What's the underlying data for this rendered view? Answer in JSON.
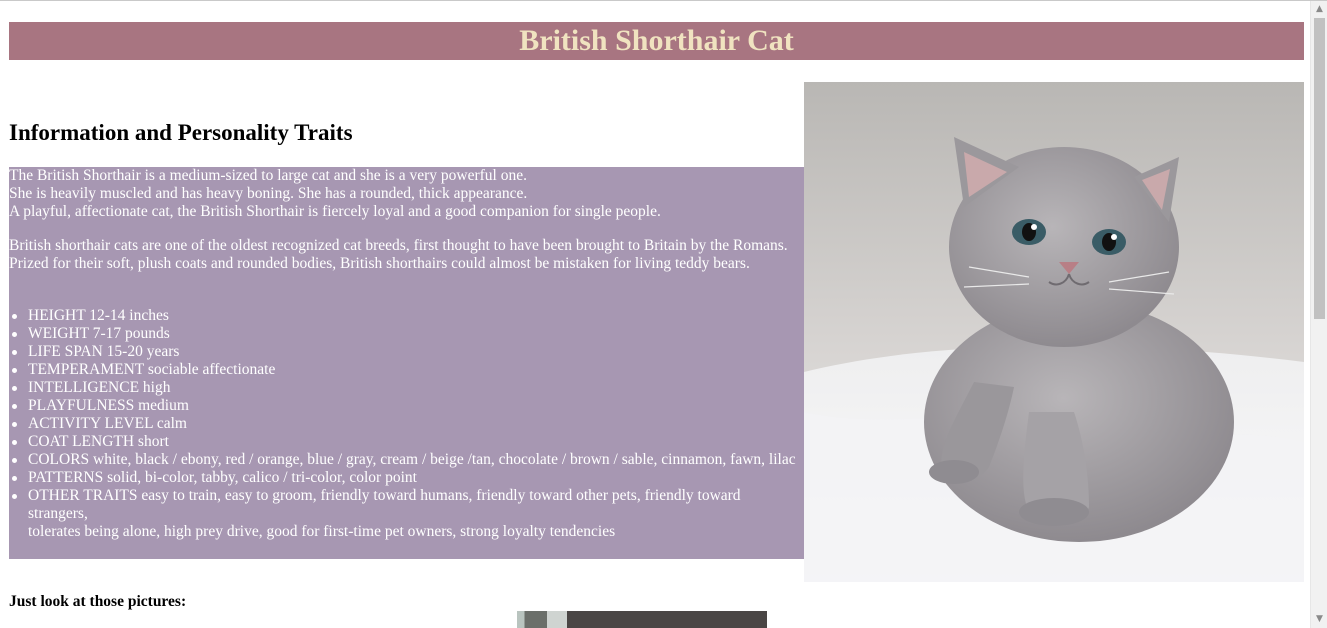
{
  "banner": {
    "title": "British Shorthair Cat"
  },
  "section": {
    "heading": "Information and Personality Traits"
  },
  "info": {
    "p1_lines": [
      "The British Shorthair is a medium-sized to large cat and she is a very powerful one.",
      "She is heavily muscled and has heavy boning. She has a rounded, thick appearance.",
      "A playful, affectionate cat, the British Shorthair is fiercely loyal and a good companion for single people."
    ],
    "p2_lines": [
      "British shorthair cats are one of the oldest recognized cat breeds, first thought to have been brought to Britain by the Romans.",
      "Prized for their soft, plush coats and rounded bodies, British shorthairs could almost be mistaken for living teddy bears."
    ],
    "traits": [
      "HEIGHT 12-14 inches",
      "WEIGHT 7-17 pounds",
      "LIFE SPAN 15-20 years",
      "TEMPERAMENT sociable affectionate",
      "INTELLIGENCE high",
      "PLAYFULNESS medium",
      "ACTIVITY LEVEL calm",
      "COAT LENGTH short",
      "COLORS white, black / ebony, red / orange, blue / gray, cream / beige /tan, chocolate / brown / sable, cinnamon, fawn, lilac",
      "PATTERNS solid, bi-color, tabby, calico / tri-color, color point",
      "OTHER TRAITS easy to train, easy to groom, friendly toward humans, friendly toward other pets, friendly toward strangers,",
      "tolerates being alone, high prey drive, good for first-time pet owners, strong loyalty tendencies"
    ]
  },
  "pictures": {
    "label": "Just look at those pictures:"
  },
  "colors": {
    "banner_bg": "#a87581",
    "banner_text": "#f0e3c0",
    "info_bg": "#a797b2",
    "info_text": "#ffffff"
  },
  "icons": {
    "scroll_up": "scroll-up-arrow-icon",
    "scroll_down": "scroll-down-arrow-icon"
  }
}
